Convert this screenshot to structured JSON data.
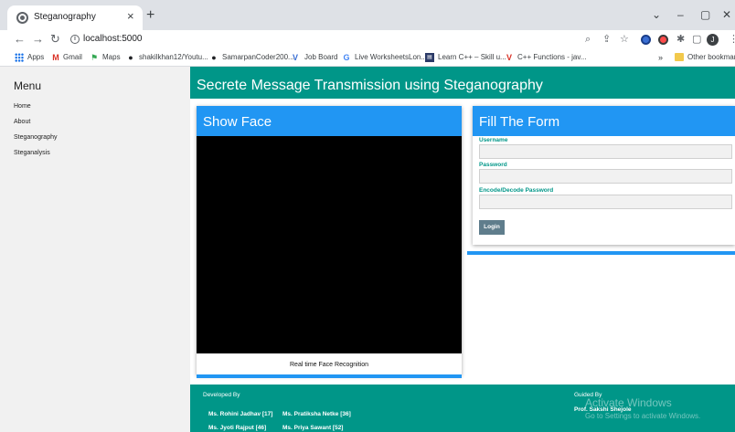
{
  "browser": {
    "tab_title": "Steganography",
    "tab_close": "×",
    "new_tab": "+",
    "window_controls": [
      "⌄",
      "–",
      "▢",
      "✕"
    ],
    "url": "localhost:5000",
    "profile_initial": "J",
    "bookmarks": [
      {
        "label": "Apps",
        "icon": "apps-grid-icon"
      },
      {
        "label": "Gmail",
        "icon": "gmail-icon"
      },
      {
        "label": "Maps",
        "icon": "maps-icon"
      },
      {
        "label": "shakilkhan12/Youtu...",
        "icon": "github-icon"
      },
      {
        "label": "SamarpanCoder200...",
        "icon": "github-icon"
      },
      {
        "label": "Job Board",
        "icon": "vue-icon"
      },
      {
        "label": "Live WorksheetsLon...",
        "icon": "google-icon"
      },
      {
        "label": "Learn C++ – Skill u...",
        "icon": "learn-icon"
      },
      {
        "label": "C++ Functions - jav...",
        "icon": "vue-red-icon"
      }
    ],
    "bookmarks_overflow": "»",
    "other_bookmarks": "Other bookmarks"
  },
  "sidebar": {
    "title": "Menu",
    "items": [
      "Home",
      "About",
      "Steganography",
      "Steganalysis"
    ]
  },
  "header": {
    "title": "Secrete Message Transmission using Steganography"
  },
  "face_card": {
    "title": "Show Face",
    "caption": "Real time Face Recognition"
  },
  "form_card": {
    "title": "Fill The Form",
    "fields": [
      {
        "label": "Username",
        "value": ""
      },
      {
        "label": "Password",
        "value": ""
      },
      {
        "label": "Encode/Decode Password",
        "value": ""
      }
    ],
    "login_label": "Login"
  },
  "footer": {
    "developed_by": "Developed By",
    "developers": [
      "Ms. Rohini Jadhav [17]",
      "Ms. Pratiksha Netke [36]",
      "Ms. Jyoti Rajput [46]",
      "Ms. Priya Sawant [52]"
    ],
    "guided_by": "Guided By",
    "guide": "Prof. Sakshi Shejole"
  },
  "watermark": {
    "line1": "Activate Windows",
    "line2": "Go to Settings to activate Windows."
  },
  "colors": {
    "teal": "#009688",
    "blue": "#2196f3",
    "button": "#5f7d8c"
  }
}
